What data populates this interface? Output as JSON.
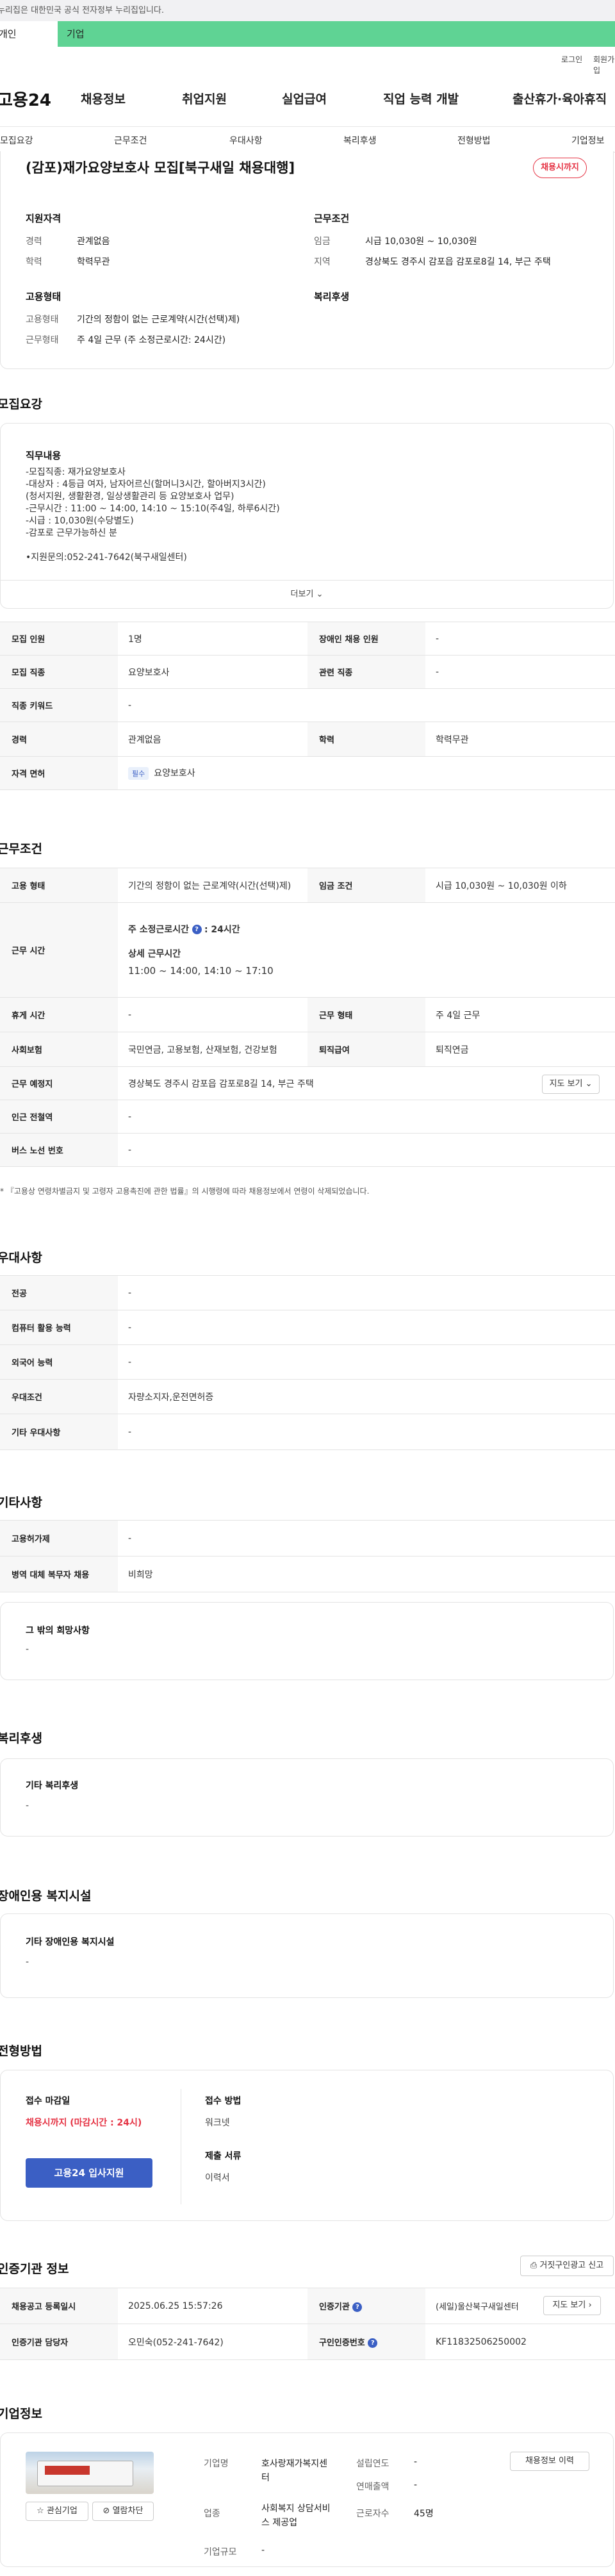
{
  "gov_bar": "이 누리집은 대한민국 공식 전자정부 누리집입니다.",
  "tabs": {
    "personal": "개인",
    "company": "기업"
  },
  "util": {
    "login": "로그인",
    "signup": "회원가입"
  },
  "logo": "고용24",
  "gnb": [
    "채용정보",
    "취업지원",
    "실업급여",
    "직업 능력 개발",
    "출산휴가·육아휴직"
  ],
  "anchors": [
    "모집요강",
    "근무조건",
    "우대사항",
    "복리후생",
    "전형방법",
    "기업정보"
  ],
  "job": {
    "title": "(감포)재가요양보호사 모집[북구새일 채용대행]",
    "status_badge": "채용시까지",
    "qual_h": "지원자격",
    "cond_h": "근무조건",
    "emp_h": "고용형태",
    "welfare_h": "복리후생",
    "career_k": "경력",
    "career_v": "관계없음",
    "edu_k": "학력",
    "edu_v": "학력무관",
    "wage_k": "임금",
    "wage_v": "시급 10,030원 ~ 10,030원",
    "region_k": "지역",
    "region_v": "경상북도 경주시 감포읍 감포로8길 14, 부근 주택",
    "emptype_k": "고용형태",
    "emptype_v": "기간의 정함이 없는 근로계약(시간(선택)제)",
    "worktype_k": "근무형태",
    "worktype_v": "주 4일 근무 (주 소정근로시간: 24시간)"
  },
  "recruit": {
    "title": "모집요강",
    "duty_h": "직무내용",
    "description": "-모집직종: 재가요양보호사\n-대상자 : 4등급 여자, 남자어르신(할머니3시간, 할아버지3시간)\n(청서지원, 생활환경, 일상생활관리 등 요양보호사 업무)\n-근무시간 : 11:00 ~ 14:00, 14:10 ~ 15:10(주4일, 하루6시간)\n-시급 : 10,030원(수당별도)\n-감포로 근무가능하신 분\n\n•지원문의:052-241-7642(북구새일센터)",
    "more": "더보기",
    "rows": [
      {
        "k1": "모집 인원",
        "v1": "1명",
        "k2": "장애인 채용 인원",
        "v2": "-"
      },
      {
        "k1": "모집 직종",
        "v1": "요양보호사",
        "k2": "관련 직종",
        "v2": "-"
      },
      {
        "k1": "직종 키워드",
        "v1": "-"
      },
      {
        "k1": "경력",
        "v1": "관계없음",
        "k2": "학력",
        "v2": "학력무관"
      }
    ],
    "license_k": "자격 면허",
    "license_tag": "필수",
    "license_v": "요양보호사"
  },
  "work": {
    "title": "근무조건",
    "emptype_k": "고용 형태",
    "emptype_v": "기간의 정함이 없는 근로계약(시간(선택)제)",
    "wage_k": "임금 조건",
    "wage_v": "시급 10,030원 ~ 10,030원 이하",
    "hours_k": "근무 시간",
    "hours_week_label": "주 소정근로시간",
    "hours_week_value": ": 24시간",
    "hours_detail_h": "상세 근무시간",
    "hours_detail_v": "11:00 ~ 14:00, 14:10 ~ 17:10",
    "break_k": "휴게 시간",
    "break_v": "-",
    "form_k": "근무 형태",
    "form_v": "주 4일 근무",
    "ins_k": "사회보험",
    "ins_v": "국민연금, 고용보험, 산재보험, 건강보험",
    "retire_k": "퇴직급여",
    "retire_v": "퇴직연금",
    "place_k": "근무 예정지",
    "place_v": "경상북도 경주시 감포읍 감포로8길 14, 부근 주택",
    "map_btn": "지도 보기",
    "subway_k": "인근 전철역",
    "subway_v": "-",
    "bus_k": "버스 노선 번호",
    "bus_v": "-",
    "note": "『고용상 연령차별금지 및 고령자 고용촉진에 관한 법률』의 시행령에 따라 채용정보에서 연령이 삭제되었습니다."
  },
  "prefer": {
    "title": "우대사항",
    "rows": [
      {
        "k": "전공",
        "v": "-"
      },
      {
        "k": "컴퓨터 활용 능력",
        "v": "-"
      },
      {
        "k": "외국어 능력",
        "v": "-"
      },
      {
        "k": "우대조건",
        "v": "자량소지자,운전면허증"
      },
      {
        "k": "기타 우대사항",
        "v": "-"
      }
    ]
  },
  "etc": {
    "title": "기타사항",
    "rows": [
      {
        "k": "고용허가제",
        "v": "-"
      },
      {
        "k": "병역 대체 복무자 채용",
        "v": "비희망"
      }
    ],
    "other_h": "그 밖의 희망사항",
    "other_v": "-"
  },
  "welfare": {
    "title": "복리후생",
    "h": "기타 복리후생",
    "v": "-"
  },
  "disabled": {
    "title": "장애인용 복지시설",
    "h": "기타 장애인용 복지시설",
    "v": "-"
  },
  "process": {
    "title": "전형방법",
    "deadline_h": "접수 마감일",
    "deadline_v": "채용시까지 (마감시간 : 24시)",
    "apply_btn": "고용24 입사지원",
    "method_h": "접수 방법",
    "method_v": "워크넷",
    "docs_h": "제출 서류",
    "docs_v": "이력서"
  },
  "cert": {
    "title": "인증기관 정보",
    "report_btn": "거짓구인광고 신고",
    "reg_k": "채용공고 등록일시",
    "reg_v": "2025.06.25 15:57:26",
    "org_k": "인증기관",
    "org_v": "(세일)울산북구새일센터",
    "map_btn": "지도 보기",
    "mgr_k": "인증기관 담당자",
    "mgr_v": "오민숙(052-241-7642)",
    "num_k": "구인인증번호",
    "num_v": "KF11832506250002"
  },
  "company": {
    "title": "기업정보",
    "fav_btn": "관심기업",
    "block_btn": "열람차단",
    "history_btn": "채용정보 이력",
    "name_k": "기업명",
    "name_v": "호사랑재가복지센터",
    "est_k": "설립연도",
    "est_v": "-",
    "sales_k": "연매출액",
    "sales_v": "-",
    "industry_k": "업종",
    "industry_v": "사회복지 상담서비스 제공업",
    "emp_k": "근로자수",
    "emp_v": "45명",
    "size_k": "기업규모",
    "size_v": "-"
  },
  "colors": {
    "accent": "#3b5fc4",
    "green": "#5fd394",
    "red": "#e53344"
  }
}
